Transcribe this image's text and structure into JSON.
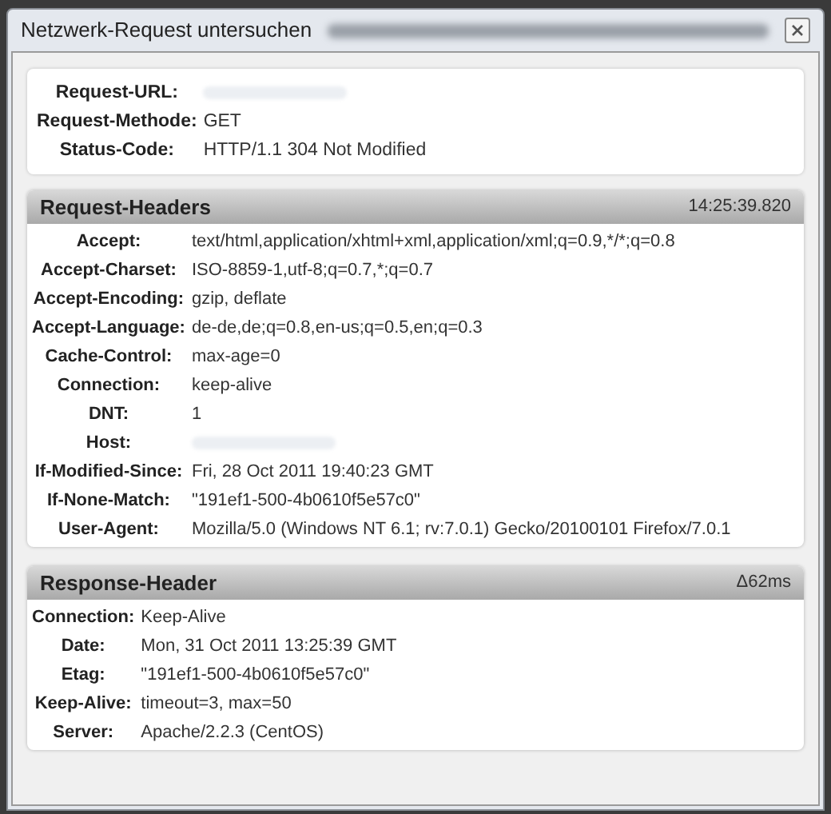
{
  "window": {
    "title": "Netzwerk-Request untersuchen",
    "title_redacted": true
  },
  "summary": [
    {
      "label": "Request-URL:",
      "redacted": true
    },
    {
      "label": "Request-Methode:",
      "value": "GET"
    },
    {
      "label": "Status-Code:",
      "value": "HTTP/1.1 304 Not Modified"
    }
  ],
  "sections": [
    {
      "title": "Request-Headers",
      "time": "14:25:39.820",
      "headers": [
        {
          "label": "Accept:",
          "value": "text/html,application/xhtml+xml,application/xml;q=0.9,*/*;q=0.8"
        },
        {
          "label": "Accept-Charset:",
          "value": "ISO-8859-1,utf-8;q=0.7,*;q=0.7"
        },
        {
          "label": "Accept-Encoding:",
          "value": "gzip, deflate"
        },
        {
          "label": "Accept-Language:",
          "value": "de-de,de;q=0.8,en-us;q=0.5,en;q=0.3"
        },
        {
          "label": "Cache-Control:",
          "value": "max-age=0"
        },
        {
          "label": "Connection:",
          "value": "keep-alive"
        },
        {
          "label": "DNT:",
          "value": "1"
        },
        {
          "label": "Host:",
          "redacted": true
        },
        {
          "label": "If-Modified-Since:",
          "value": "Fri, 28 Oct 2011 19:40:23 GMT"
        },
        {
          "label": "If-None-Match:",
          "value": "\"191ef1-500-4b0610f5e57c0\""
        },
        {
          "label": "User-Agent:",
          "value": "Mozilla/5.0 (Windows NT 6.1; rv:7.0.1) Gecko/20100101 Firefox/7.0.1"
        }
      ]
    },
    {
      "title": "Response-Header",
      "time": "Δ62ms",
      "headers": [
        {
          "label": "Connection:",
          "value": "Keep-Alive"
        },
        {
          "label": "Date:",
          "value": "Mon, 31 Oct 2011 13:25:39 GMT"
        },
        {
          "label": "Etag:",
          "value": "\"191ef1-500-4b0610f5e57c0\""
        },
        {
          "label": "Keep-Alive:",
          "value": "timeout=3, max=50"
        },
        {
          "label": "Server:",
          "value": "Apache/2.2.3 (CentOS)"
        }
      ]
    }
  ]
}
